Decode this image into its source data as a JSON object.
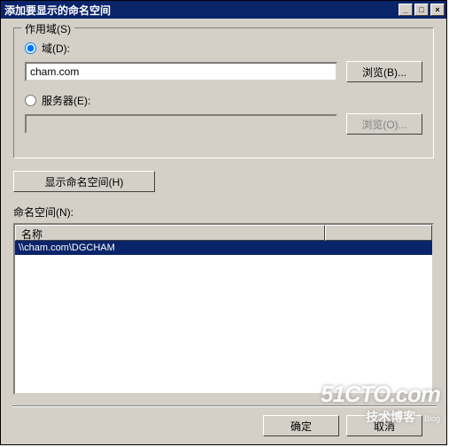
{
  "title": "添加要显示的命名空间",
  "titlebar_buttons": {
    "min": "_",
    "max": "□",
    "close": "×"
  },
  "scope": {
    "legend": "作用域(S)",
    "domain_radio_label": "域(D):",
    "domain_value": "cham.com",
    "domain_browse": "浏览(B)...",
    "server_radio_label": "服务器(E):",
    "server_value": "",
    "server_browse": "浏览(O)..."
  },
  "show_namespace_btn": "显示命名空间(H)",
  "namespace_label": "命名空间(N):",
  "listview": {
    "header": "名称",
    "rows": [
      "\\\\cham.com\\DGCHAM"
    ]
  },
  "buttons": {
    "ok": "确定",
    "cancel": "取消"
  },
  "watermark": {
    "line1": "51CTO.com",
    "line2": "技术博客",
    "blog": "Blog"
  }
}
